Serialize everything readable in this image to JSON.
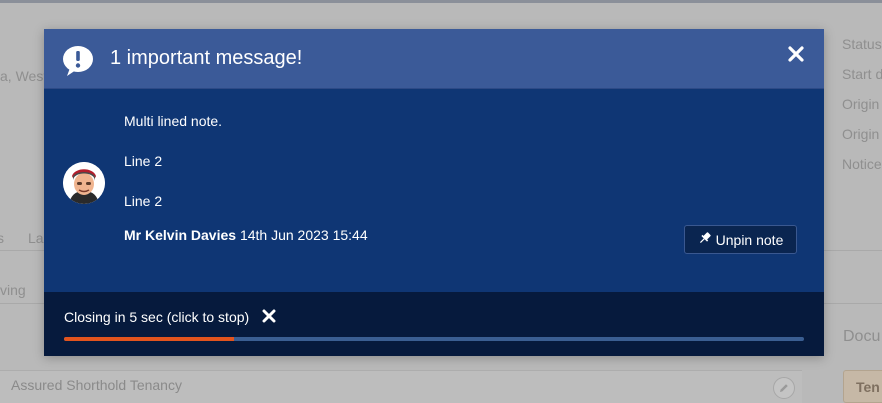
{
  "background": {
    "left_text": "a, West",
    "right_labels": [
      "Status",
      "Start d",
      "Origin",
      "Origin",
      "Notice"
    ],
    "tabs_partial": [
      "s",
      "La"
    ],
    "row_partial": "ving",
    "panel_text": "Assured Shorthold Tenancy",
    "docs_heading": "Docu",
    "doc_tab": "Ten"
  },
  "modal": {
    "title": "1 important message!",
    "note_lines": [
      "Multi lined note.",
      "Line 2",
      "Line 2"
    ],
    "author": "Mr Kelvin Davies",
    "timestamp": "14th Jun 2023 15:44",
    "unpin_label": "Unpin note",
    "closing_text": "Closing in 5 sec (click to stop)",
    "progress_fraction": 0.23,
    "colors": {
      "header": "#3b5a98",
      "body": "#0f3674",
      "footer": "#061a3d",
      "progress": "#e2541e",
      "track": "#3a5e92"
    },
    "icons": {
      "header": "speech-bubble-exclamation-icon",
      "close": "close-icon",
      "unpin": "pin-icon",
      "stop": "close-icon"
    }
  }
}
